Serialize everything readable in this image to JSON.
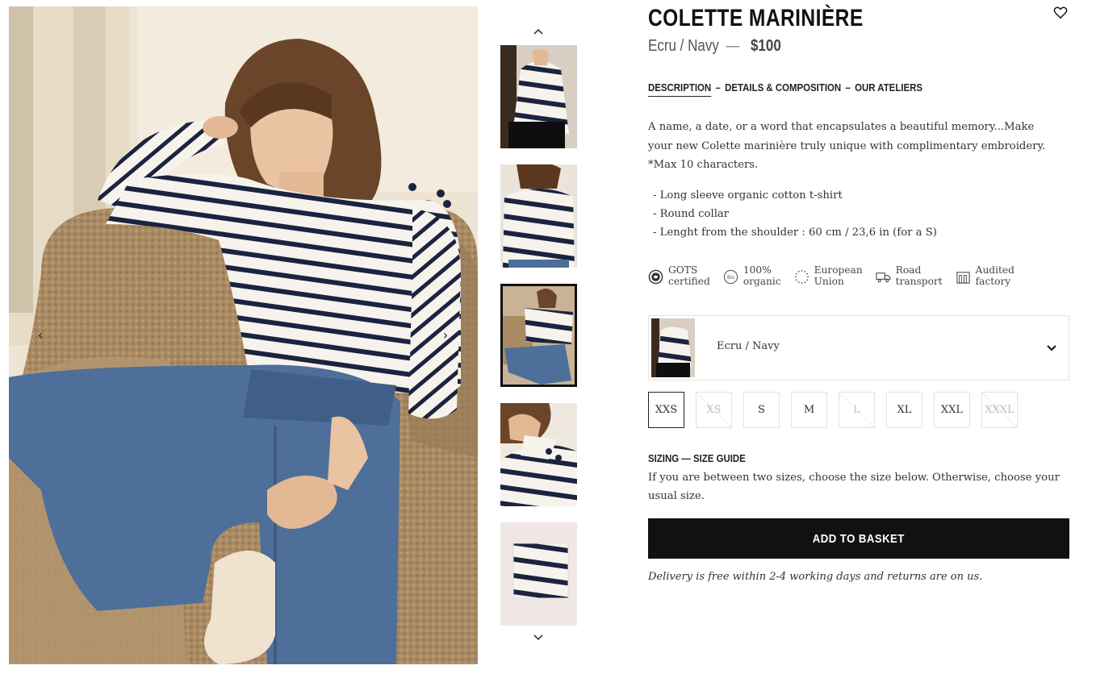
{
  "product": {
    "title": "COLETTE MARINIÈRE",
    "colorway": "Ecru / Navy",
    "separator": "—",
    "price": "$100"
  },
  "tabs": [
    {
      "label": "DESCRIPTION",
      "active": true
    },
    {
      "label": "–"
    },
    {
      "label": "DETAILS & COMPOSITION"
    },
    {
      "label": "–"
    },
    {
      "label": "OUR ATELIERS"
    }
  ],
  "description": {
    "text": "A name, a date, or a word that encapsulates a beautiful memory...Make your new Colette marinière truly unique with complimentary embroidery.",
    "note": "*Max 10 characters.",
    "bullets": [
      "Long sleeve organic cotton t-shirt",
      "Round collar",
      "Lenght from the shoulder : 60 cm / 23,6 in (for a S)"
    ]
  },
  "badges": [
    {
      "icon": "gots-icon",
      "line1": "GOTS",
      "line2": "certified"
    },
    {
      "icon": "bio-icon",
      "line1": "100%",
      "line2": "organic"
    },
    {
      "icon": "eu-stars-icon",
      "line1": "European",
      "line2": "Union"
    },
    {
      "icon": "truck-icon",
      "line1": "Road",
      "line2": "transport"
    },
    {
      "icon": "factory-icon",
      "line1": "Audited",
      "line2": "factory"
    }
  ],
  "color_select": {
    "value": "Ecru / Navy"
  },
  "sizes": [
    {
      "label": "XXS",
      "state": "selected"
    },
    {
      "label": "XS",
      "state": "unavailable"
    },
    {
      "label": "S",
      "state": "available"
    },
    {
      "label": "M",
      "state": "available"
    },
    {
      "label": "L",
      "state": "unavailable"
    },
    {
      "label": "XL",
      "state": "available"
    },
    {
      "label": "XXL",
      "state": "available"
    },
    {
      "label": "XXXL",
      "state": "unavailable"
    }
  ],
  "sizing": {
    "title": "SIZING",
    "dash": "—",
    "guide_link": "SIZE GUIDE",
    "text": "If you are between two sizes, choose the size below. Otherwise, choose your usual size."
  },
  "cta": {
    "add_to_basket": "ADD TO BASKET"
  },
  "delivery": "Delivery is free within 2-4 working days and returns are on us.",
  "colors": {
    "button_bg": "#111111",
    "navy_stripe": "#1c2340",
    "denim": "#4d6f9a",
    "chair": "#a98a62"
  },
  "gallery": {
    "thumb_count": 5,
    "active_thumb": 3
  }
}
